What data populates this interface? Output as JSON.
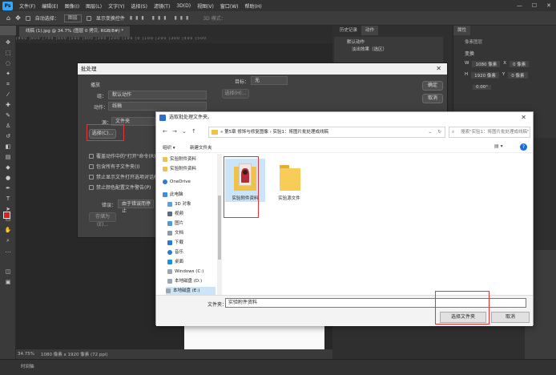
{
  "menu": [
    "文件(F)",
    "编辑(E)",
    "图像(I)",
    "图层(L)",
    "文字(Y)",
    "选择(S)",
    "滤镜(T)",
    "3D(D)",
    "视图(V)",
    "窗口(W)",
    "帮助(H)"
  ],
  "options_bar": {
    "auto_select": "自动选择：",
    "auto_select_value": "图层",
    "show_transform": "显示变换控件",
    "mode_3d": "3D 模式："
  },
  "doc_tab": "线稿 (1).jpg @ 34.7% (图层 0 拷贝, RGB/8#) *",
  "status": {
    "zoom": "34.75%",
    "size": "1080 像素 x 1920 像素 (72 ppi)"
  },
  "timeline": "时间轴",
  "panels": {
    "history": "历史记录",
    "actions": "动作",
    "properties": "属性",
    "default_actions": "默认动作",
    "sub_action": "淡出效果（选区）",
    "doc_label": "像素图层",
    "transform": "变换",
    "w": "W",
    "h": "H",
    "x": "X",
    "y": "Y",
    "w_val": "1080 像素",
    "h_val": "1920 像素",
    "x_val": "0 像素",
    "y_val": "0 像素",
    "angle": "0.00°"
  },
  "batch": {
    "title": "批处理",
    "play": "播放",
    "set_label": "组：",
    "set_value": "默认动作",
    "action_label": "动作：",
    "action_value": "线稿",
    "source_label": "源：",
    "source_value": "文件夹",
    "choose": "选择(C)...",
    "opt1": "覆盖动作中的\"打开\"命令(R)",
    "opt2": "包含所有子文件夹(I)",
    "opt3": "禁止显示文件打开选项对话框(F)",
    "opt4": "禁止颜色配置文件警告(P)",
    "errors_label": "错误：",
    "errors_value": "由于错误而停止",
    "save_as": "存储为(E)...",
    "dest_label": "目标：",
    "dest_value": "无",
    "dest_choose": "选择(H)...",
    "ok": "确定",
    "cancel": "取消"
  },
  "chooser": {
    "title": "选取批处理文件夹。",
    "path": "« 第5章 修饰与修复图像 › 实验1：将图片批处理成线稿",
    "search_placeholder": "搜索\"实验1：将图片批处理成线稿\"",
    "organize": "组织 ▾",
    "new_folder": "新建文件夹",
    "nav": [
      "实验附件资料",
      "实验附件资料",
      "OneDrive",
      "此电脑",
      "3D 对象",
      "视频",
      "图片",
      "文档",
      "下载",
      "音乐",
      "桌面",
      "Windows (C:)",
      "本地磁盘 (D:)",
      "本地磁盘 (E:)"
    ],
    "files": [
      "实验附件资料",
      "实验源文件"
    ],
    "folder_label": "文件夹：",
    "folder_value": "实验附件资料",
    "select": "选择文件夹",
    "cancel": "取消"
  },
  "colors": {
    "accent_red": "#e0383a",
    "folder": "#f0c24a",
    "ps_blue": "#31a8ff"
  }
}
